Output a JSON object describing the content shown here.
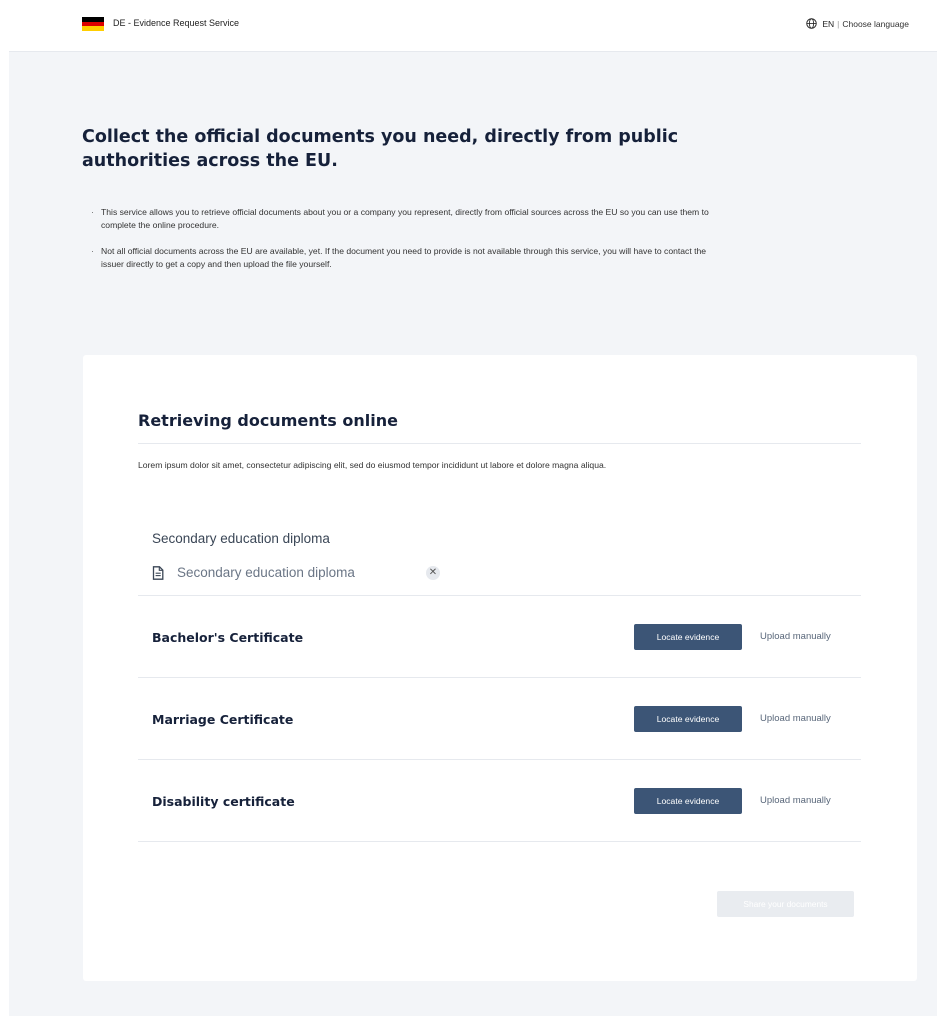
{
  "header": {
    "service_name": "DE - Evidence Request Service",
    "language_code": "EN",
    "language_separator": "|",
    "choose_language": "Choose language",
    "flag_colors": [
      "#000000",
      "#dd0000",
      "#ffce00"
    ]
  },
  "intro": {
    "title": "Collect the official documents you need, directly from public authorities across the EU.",
    "bullets": [
      "This service allows you to retrieve official documents about you or a company you represent, directly from official sources across the EU so you can use them to complete the online procedure.",
      "Not all official documents across the EU are available, yet. If the document you need to provide is not available through this service, you will have to contact the issuer directly to get a copy and then upload the file yourself."
    ]
  },
  "card": {
    "title": "Retrieving documents online",
    "description": "Lorem ipsum dolor sit amet, consectetur adipiscing elit, sed do eiusmod tempor incididunt ut labore et dolore magna aliqua.",
    "completed_document": {
      "name": "Secondary education diploma",
      "attached_file": "Secondary education diploma",
      "remove_icon": "close-circle-icon"
    },
    "documents": [
      {
        "name": "Bachelor's Certificate",
        "locate_label": "Locate evidence",
        "upload_label": "Upload manually"
      },
      {
        "name": "Marriage Certificate",
        "locate_label": "Locate evidence",
        "upload_label": "Upload manually"
      },
      {
        "name": "Disability certificate",
        "locate_label": "Locate evidence",
        "upload_label": "Upload manually"
      }
    ],
    "share_button": "Share your documents",
    "share_button_state": "disabled"
  },
  "colors": {
    "primary_button": "#3c5576",
    "page_background": "#f3f5f8",
    "heading": "#16213a"
  }
}
